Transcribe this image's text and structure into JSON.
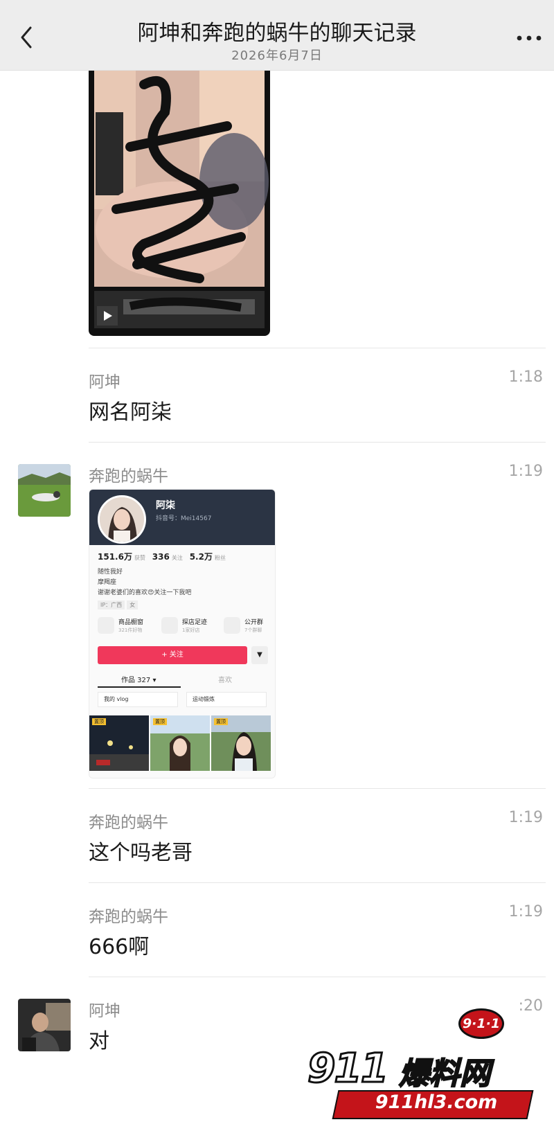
{
  "header": {
    "title": "阿坤和奔跑的蜗牛的聊天记录",
    "date": "2026年6月7日",
    "back_icon": "chevron-left-icon",
    "more_icon": "more-dots-icon"
  },
  "messages": [
    {
      "sender": "阿坤",
      "time": "1:18",
      "text": "网名阿柒"
    },
    {
      "sender": "奔跑的蜗牛",
      "time": "1:19",
      "card": {
        "name": "阿柒",
        "id": "抖音号：Mei14567",
        "stats": [
          {
            "value": "151.6万",
            "label": "获赞"
          },
          {
            "value": "336",
            "label": "关注"
          },
          {
            "value": "5.2万",
            "label": "粉丝"
          }
        ],
        "bio": [
          "随性我好",
          "摩羯座",
          "谢谢老婆们的喜欢😍关注一下我吧"
        ],
        "tags": [
          "IP：广西",
          "女"
        ],
        "shortcuts": [
          {
            "title": "商品橱窗",
            "sub": "321件好物"
          },
          {
            "title": "探店足迹",
            "sub": "1家好店"
          },
          {
            "title": "公开群",
            "sub": "7个群聊"
          }
        ],
        "follow_label": "+ 关注",
        "filter_label": "▼",
        "tab_works": "作品 327 ▾",
        "tab_like": "喜欢",
        "collections": [
          "我的 vlog",
          "运动锻炼"
        ],
        "pin_label": "置顶"
      }
    },
    {
      "sender": "奔跑的蜗牛",
      "time": "1:19",
      "text": "这个吗老哥"
    },
    {
      "sender": "奔跑的蜗牛",
      "time": "1:19",
      "text": "666啊"
    },
    {
      "sender": "阿坤",
      "time": ":20",
      "text": "对"
    }
  ],
  "watermark": {
    "badge": "9·1·1",
    "number": "911",
    "brand": "爆料网",
    "url": "911hl3.com"
  },
  "colors": {
    "header_bg": "#ededed",
    "follow_button": "#f0385b",
    "watermark_red": "#c4141a"
  }
}
